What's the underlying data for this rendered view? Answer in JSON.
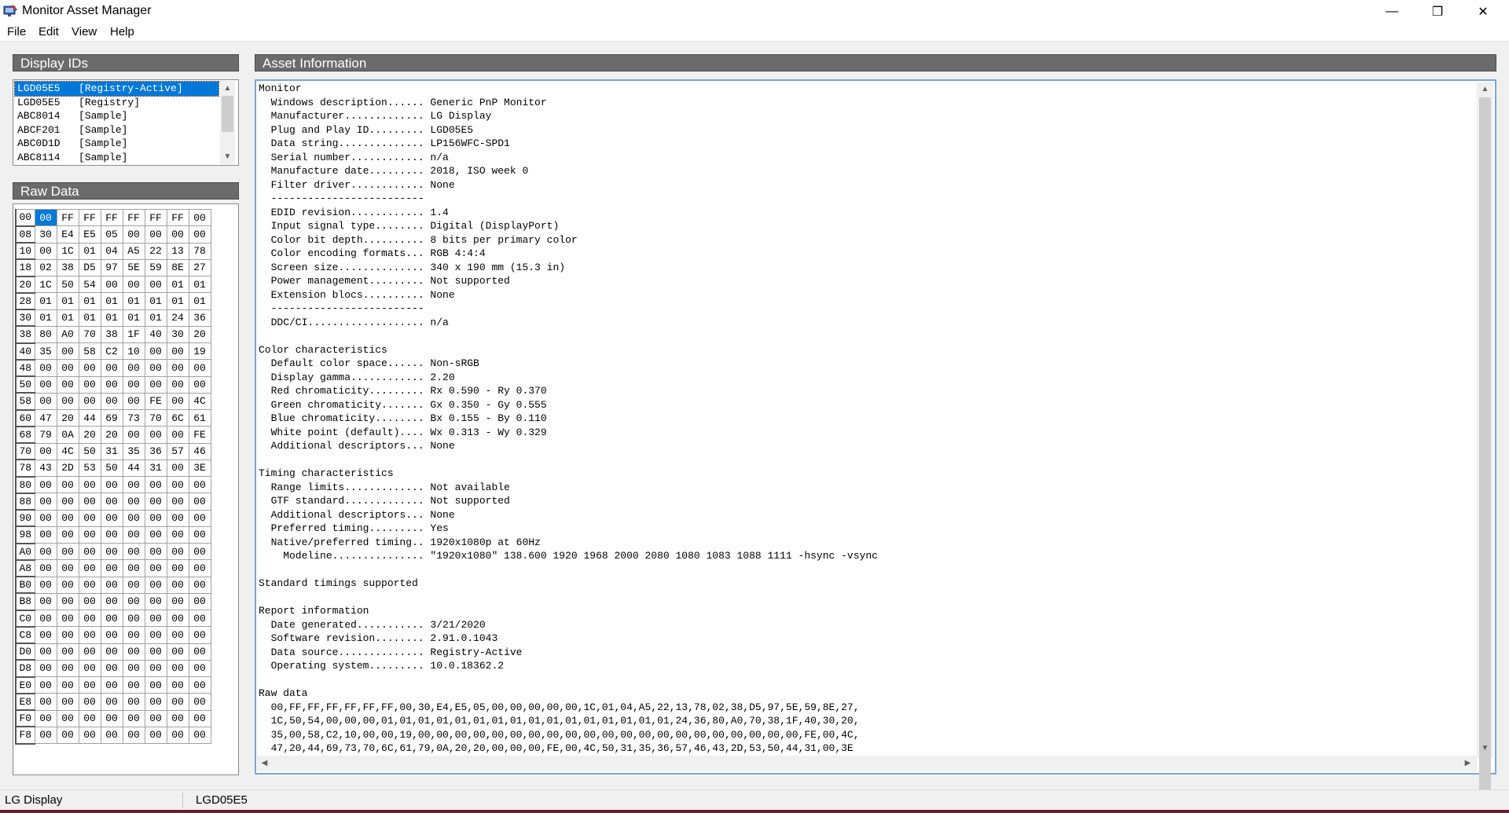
{
  "window": {
    "title": "Monitor Asset Manager",
    "minimize_glyph": "—",
    "maximize_glyph": "❐",
    "close_glyph": "✕"
  },
  "menu": [
    "File",
    "Edit",
    "View",
    "Help"
  ],
  "display_ids": {
    "title": "Display IDs",
    "items": [
      "LGD05E5   [Registry-Active]",
      "LGD05E5   [Registry]",
      "ABC8014   [Sample]",
      "ABCF201   [Sample]",
      "ABC0D1D   [Sample]",
      "ABC8114   [Sample]"
    ],
    "selected_index": 0
  },
  "raw_data": {
    "title": "Raw Data",
    "rows": [
      [
        "00",
        "00",
        "FF",
        "FF",
        "FF",
        "FF",
        "FF",
        "FF",
        "00"
      ],
      [
        "08",
        "30",
        "E4",
        "E5",
        "05",
        "00",
        "00",
        "00",
        "00"
      ],
      [
        "10",
        "00",
        "1C",
        "01",
        "04",
        "A5",
        "22",
        "13",
        "78"
      ],
      [
        "18",
        "02",
        "38",
        "D5",
        "97",
        "5E",
        "59",
        "8E",
        "27"
      ],
      [
        "20",
        "1C",
        "50",
        "54",
        "00",
        "00",
        "00",
        "01",
        "01"
      ],
      [
        "28",
        "01",
        "01",
        "01",
        "01",
        "01",
        "01",
        "01",
        "01"
      ],
      [
        "30",
        "01",
        "01",
        "01",
        "01",
        "01",
        "01",
        "24",
        "36"
      ],
      [
        "38",
        "80",
        "A0",
        "70",
        "38",
        "1F",
        "40",
        "30",
        "20"
      ],
      [
        "40",
        "35",
        "00",
        "58",
        "C2",
        "10",
        "00",
        "00",
        "19"
      ],
      [
        "48",
        "00",
        "00",
        "00",
        "00",
        "00",
        "00",
        "00",
        "00"
      ],
      [
        "50",
        "00",
        "00",
        "00",
        "00",
        "00",
        "00",
        "00",
        "00"
      ],
      [
        "58",
        "00",
        "00",
        "00",
        "00",
        "00",
        "FE",
        "00",
        "4C"
      ],
      [
        "60",
        "47",
        "20",
        "44",
        "69",
        "73",
        "70",
        "6C",
        "61"
      ],
      [
        "68",
        "79",
        "0A",
        "20",
        "20",
        "00",
        "00",
        "00",
        "FE"
      ],
      [
        "70",
        "00",
        "4C",
        "50",
        "31",
        "35",
        "36",
        "57",
        "46"
      ],
      [
        "78",
        "43",
        "2D",
        "53",
        "50",
        "44",
        "31",
        "00",
        "3E"
      ],
      [
        "80",
        "00",
        "00",
        "00",
        "00",
        "00",
        "00",
        "00",
        "00"
      ],
      [
        "88",
        "00",
        "00",
        "00",
        "00",
        "00",
        "00",
        "00",
        "00"
      ],
      [
        "90",
        "00",
        "00",
        "00",
        "00",
        "00",
        "00",
        "00",
        "00"
      ],
      [
        "98",
        "00",
        "00",
        "00",
        "00",
        "00",
        "00",
        "00",
        "00"
      ],
      [
        "A0",
        "00",
        "00",
        "00",
        "00",
        "00",
        "00",
        "00",
        "00"
      ],
      [
        "A8",
        "00",
        "00",
        "00",
        "00",
        "00",
        "00",
        "00",
        "00"
      ],
      [
        "B0",
        "00",
        "00",
        "00",
        "00",
        "00",
        "00",
        "00",
        "00"
      ],
      [
        "B8",
        "00",
        "00",
        "00",
        "00",
        "00",
        "00",
        "00",
        "00"
      ],
      [
        "C0",
        "00",
        "00",
        "00",
        "00",
        "00",
        "00",
        "00",
        "00"
      ],
      [
        "C8",
        "00",
        "00",
        "00",
        "00",
        "00",
        "00",
        "00",
        "00"
      ],
      [
        "D0",
        "00",
        "00",
        "00",
        "00",
        "00",
        "00",
        "00",
        "00"
      ],
      [
        "D8",
        "00",
        "00",
        "00",
        "00",
        "00",
        "00",
        "00",
        "00"
      ],
      [
        "E0",
        "00",
        "00",
        "00",
        "00",
        "00",
        "00",
        "00",
        "00"
      ],
      [
        "E8",
        "00",
        "00",
        "00",
        "00",
        "00",
        "00",
        "00",
        "00"
      ],
      [
        "F0",
        "00",
        "00",
        "00",
        "00",
        "00",
        "00",
        "00",
        "00"
      ],
      [
        "F8",
        "00",
        "00",
        "00",
        "00",
        "00",
        "00",
        "00",
        "00"
      ]
    ]
  },
  "asset_info": {
    "title": "Asset Information",
    "lines": [
      "Monitor",
      "  Windows description...... Generic PnP Monitor",
      "  Manufacturer............. LG Display",
      "  Plug and Play ID......... LGD05E5",
      "  Data string.............. LP156WFC-SPD1",
      "  Serial number............ n/a",
      "  Manufacture date......... 2018, ISO week 0",
      "  Filter driver............ None",
      "  -------------------------",
      "  EDID revision............ 1.4",
      "  Input signal type........ Digital (DisplayPort)",
      "  Color bit depth.......... 8 bits per primary color",
      "  Color encoding formats... RGB 4:4:4",
      "  Screen size.............. 340 x 190 mm (15.3 in)",
      "  Power management......... Not supported",
      "  Extension blocs.......... None",
      "  -------------------------",
      "  DDC/CI................... n/a",
      "",
      "Color characteristics",
      "  Default color space...... Non-sRGB",
      "  Display gamma............ 2.20",
      "  Red chromaticity......... Rx 0.590 - Ry 0.370",
      "  Green chromaticity....... Gx 0.350 - Gy 0.555",
      "  Blue chromaticity........ Bx 0.155 - By 0.110",
      "  White point (default).... Wx 0.313 - Wy 0.329",
      "  Additional descriptors... None",
      "",
      "Timing characteristics",
      "  Range limits............. Not available",
      "  GTF standard............. Not supported",
      "  Additional descriptors... None",
      "  Preferred timing......... Yes",
      "  Native/preferred timing.. 1920x1080p at 60Hz",
      "    Modeline............... \"1920x1080\" 138.600 1920 1968 2000 2080 1080 1083 1088 1111 -hsync -vsync",
      "",
      "Standard timings supported",
      "",
      "Report information",
      "  Date generated........... 3/21/2020",
      "  Software revision........ 2.91.0.1043",
      "  Data source.............. Registry-Active",
      "  Operating system......... 10.0.18362.2",
      "",
      "Raw data",
      "  00,FF,FF,FF,FF,FF,FF,00,30,E4,E5,05,00,00,00,00,00,1C,01,04,A5,22,13,78,02,38,D5,97,5E,59,8E,27,",
      "  1C,50,54,00,00,00,01,01,01,01,01,01,01,01,01,01,01,01,01,01,01,01,24,36,80,A0,70,38,1F,40,30,20,",
      "  35,00,58,C2,10,00,00,19,00,00,00,00,00,00,00,00,00,00,00,00,00,00,00,00,00,00,00,00,00,FE,00,4C,",
      "  47,20,44,69,73,70,6C,61,79,0A,20,20,00,00,00,FE,00,4C,50,31,35,36,57,46,43,2D,53,50,44,31,00,3E"
    ]
  },
  "status": {
    "manufacturer": "LG Display",
    "id": "LGD05E5"
  }
}
